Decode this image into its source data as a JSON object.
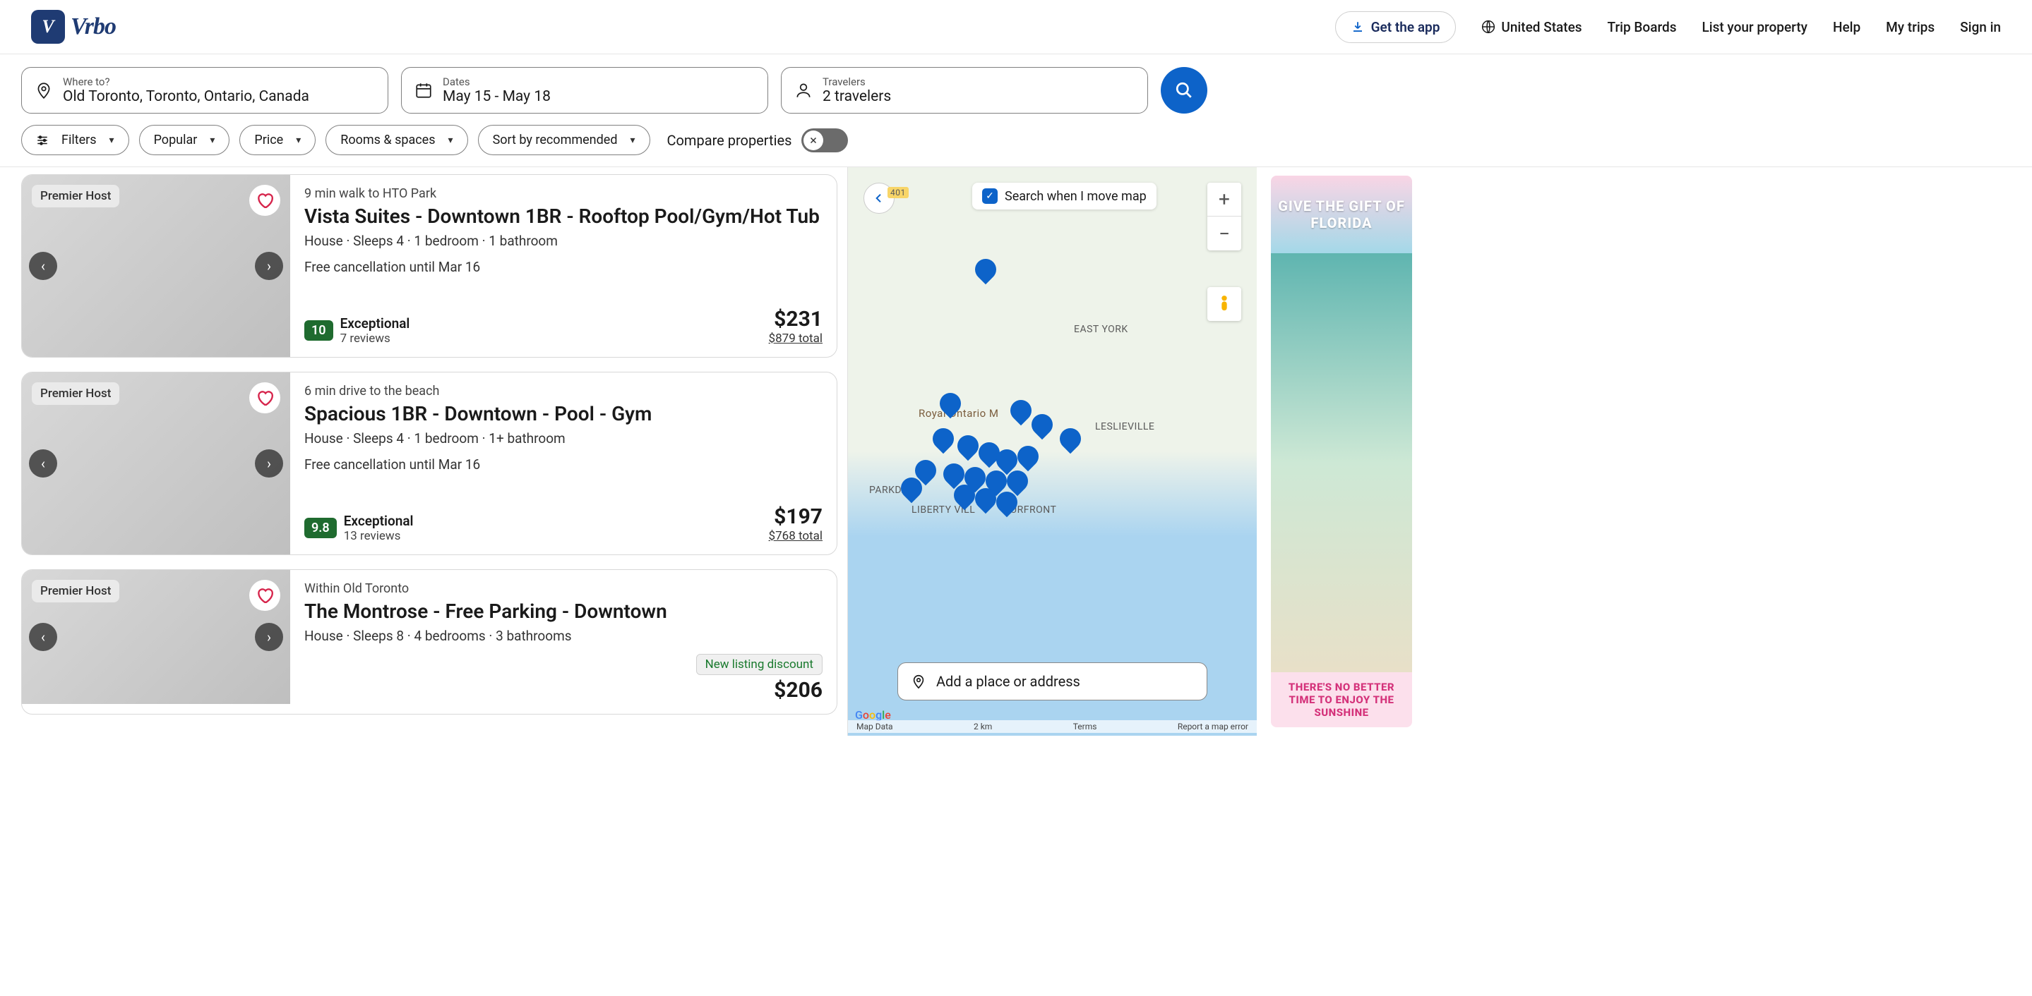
{
  "header": {
    "logo_text": "Vrbo",
    "get_app": "Get the app",
    "region": "United States",
    "nav": {
      "trip_boards": "Trip Boards",
      "list_property": "List your property",
      "help": "Help",
      "my_trips": "My trips",
      "sign_in": "Sign in"
    }
  },
  "search": {
    "where_label": "Where to?",
    "where_value": "Old Toronto, Toronto, Ontario, Canada",
    "dates_label": "Dates",
    "dates_value": "May 15 - May 18",
    "travelers_label": "Travelers",
    "travelers_value": "2 travelers"
  },
  "filters": {
    "filters": "Filters",
    "popular": "Popular",
    "price": "Price",
    "rooms": "Rooms & spaces",
    "sort": "Sort by recommended",
    "compare": "Compare properties"
  },
  "listings": [
    {
      "host_badge": "Premier Host",
      "location": "9 min walk to HTO Park",
      "title": "Vista Suites - Downtown 1BR - Rooftop Pool/Gym/Hot Tub",
      "meta": "House · Sleeps 4 · 1 bedroom · 1 bathroom",
      "cancellation": "Free cancellation until Mar 16",
      "rating_score": "10",
      "rating_label": "Exceptional",
      "rating_reviews": "7 reviews",
      "price": "$231",
      "total": "$879 total"
    },
    {
      "host_badge": "Premier Host",
      "location": "6 min drive to the beach",
      "title": "Spacious 1BR - Downtown - Pool - Gym",
      "meta": "House · Sleeps 4 · 1 bedroom · 1+ bathroom",
      "cancellation": "Free cancellation until Mar 16",
      "rating_score": "9.8",
      "rating_label": "Exceptional",
      "rating_reviews": "13 reviews",
      "price": "$197",
      "total": "$768 total"
    },
    {
      "host_badge": "Premier Host",
      "location": "Within Old Toronto",
      "title": "The Montrose - Free Parking - Downtown",
      "meta": "House · Sleeps 8 · 4 bedrooms · 3 bathrooms",
      "new_listing": "New listing discount",
      "price": "$206"
    }
  ],
  "map": {
    "search_move": "Search when I move map",
    "place_placeholder": "Add a place or address",
    "labels": {
      "east_york": "EAST YORK",
      "rom": "Royal Ontario M",
      "leslieville": "LESLIEVILLE",
      "parkdale": "PARKDALE",
      "liberty": "LIBERTY VILL",
      "urfront": "URFRONT",
      "hwy": "401"
    },
    "credits": {
      "map_data": "Map Data",
      "scale": "2 km",
      "terms": "Terms",
      "report": "Report a map error"
    }
  },
  "ad": {
    "headline": "GIVE THE GIFT OF FLORIDA",
    "footer": "THERE'S NO BETTER TIME TO ENJOY THE SUNSHINE"
  }
}
